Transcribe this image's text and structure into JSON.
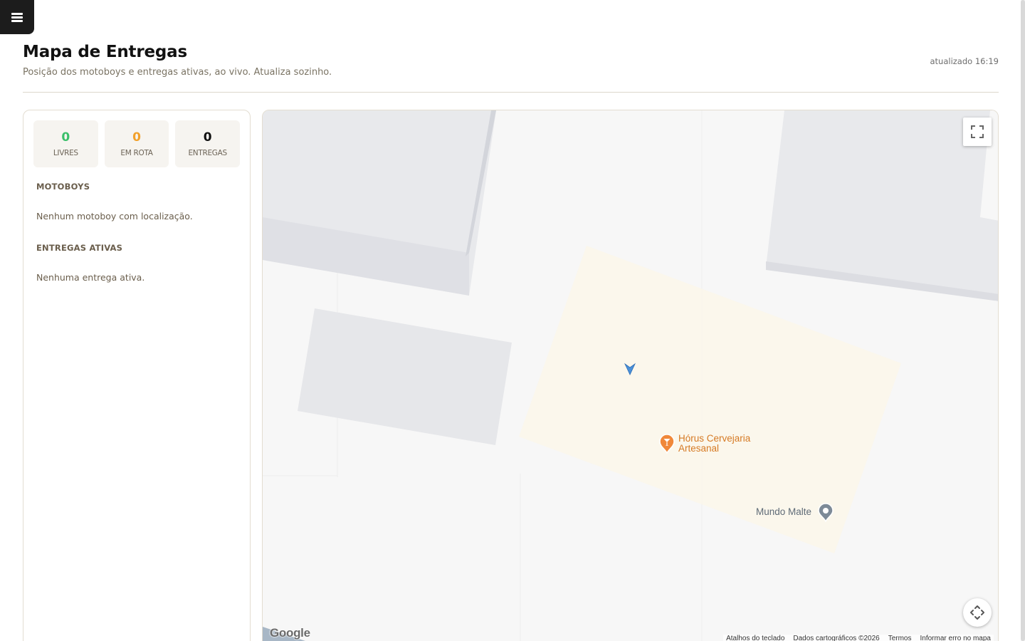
{
  "header": {
    "title": "Mapa de Entregas",
    "subtitle": "Posição dos motoboys e entregas ativas, ao vivo. Atualiza sozinho.",
    "updated_label": "atualizado",
    "updated_time": "16:19"
  },
  "stats": [
    {
      "value": "0",
      "label": "LIVRES",
      "color": "#3bbf6a"
    },
    {
      "value": "0",
      "label": "EM ROTA",
      "color": "#f2a02a"
    },
    {
      "value": "0",
      "label": "ENTREGAS",
      "color": "#111111"
    }
  ],
  "motoboys": {
    "title": "MOTOBOYS",
    "empty": "Nenhum motoboy com localização."
  },
  "entregas": {
    "title": "ENTREGAS ATIVAS",
    "empty": "Nenhuma entrega ativa."
  },
  "map": {
    "pois": {
      "horus_line1": "Hórus Cervejaria",
      "horus_line2": "Artesanal",
      "mundo": "Mundo Malte"
    },
    "google_logo": "Google",
    "attribution": {
      "shortcuts": "Atalhos do teclado",
      "data": "Dados cartográficos ©2026",
      "terms": "Termos",
      "report": "Informar erro no mapa"
    },
    "icons": {
      "menu": "menu-icon",
      "fullscreen": "fullscreen-icon",
      "pan": "pan-icon",
      "location": "navigation-arrow-icon",
      "bar_pin": "bar-pin-icon",
      "place_pin": "place-pin-icon"
    }
  }
}
